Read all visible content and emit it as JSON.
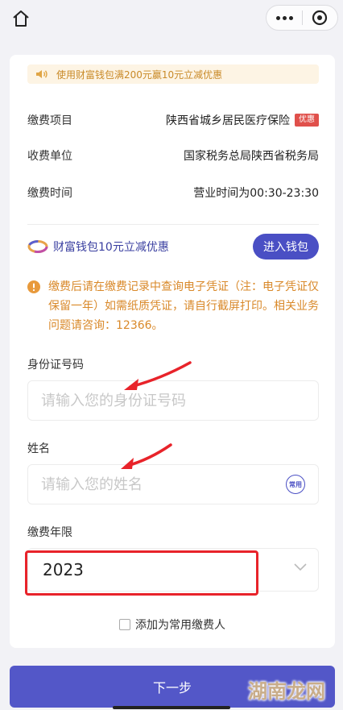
{
  "notice": {
    "text": "使用财富钱包满200元赢10元立减优惠"
  },
  "info": {
    "item_label": "缴费项目",
    "item_value": "陕西省城乡居民医疗保险",
    "item_tag": "优惠",
    "unit_label": "收费单位",
    "unit_value": "国家税务总局陕西省税务局",
    "time_label": "缴费时间",
    "time_value": "营业时间为00:30-23:30"
  },
  "wallet": {
    "text": "财富钱包10元立减优惠",
    "button": "进入钱包"
  },
  "tip": {
    "text": "缴费后请在缴费记录中查询电子凭证（注：电子凭证仅保留一年）如需纸质凭证，请自行截屏打印。相关业务问题请咨询：12366。"
  },
  "form": {
    "id_label": "身份证号码",
    "id_placeholder": "请输入您的身份证号码",
    "name_label": "姓名",
    "name_placeholder": "请输入您的姓名",
    "common_badge": "常用",
    "year_label": "缴费年限",
    "year_value": "2023",
    "checkbox_label": "添加为常用缴费人"
  },
  "next_button": "下一步",
  "watermark": "湖南龙网",
  "colors": {
    "accent": "#4a4fc4",
    "warning": "#d9892a",
    "promo_tag": "#e0504b",
    "annotation": "#e8232a"
  },
  "icons": [
    "home-icon",
    "more-dots-icon",
    "target-close-icon",
    "speaker-icon",
    "wallet-logo-icon",
    "info-icon",
    "chevron-down-icon"
  ]
}
